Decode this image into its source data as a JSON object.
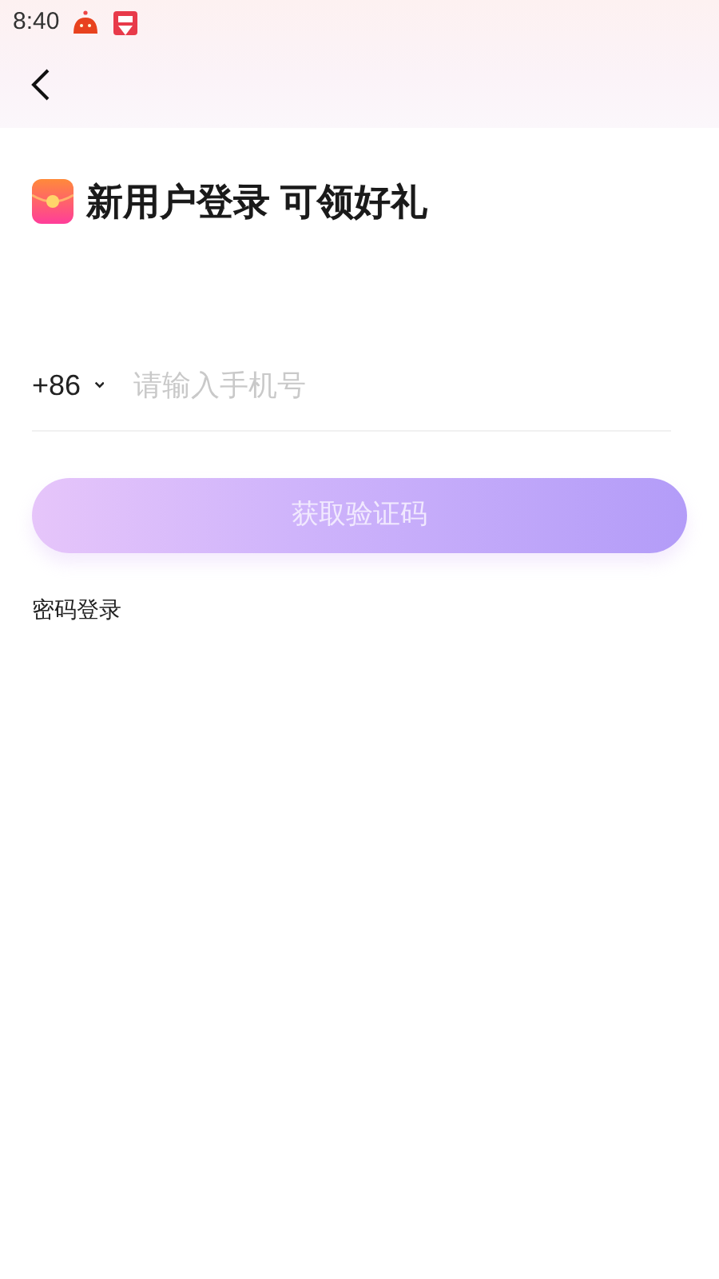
{
  "status_bar": {
    "time": "8:40"
  },
  "title": "新用户登录 可领好礼",
  "phone": {
    "country_code": "+86",
    "placeholder": "请输入手机号"
  },
  "submit": {
    "label": "获取验证码",
    "disabled": true
  },
  "alt_login": "密码登录"
}
